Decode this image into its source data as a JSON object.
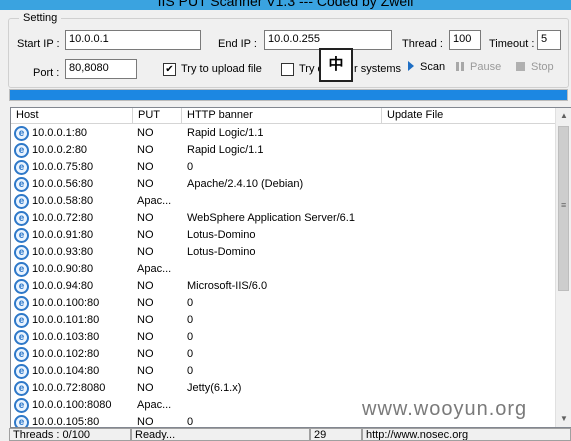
{
  "window": {
    "title": "IIS PUT Scanner V1.3 --- Coded by Zwell"
  },
  "settings": {
    "legend": "Setting",
    "start_ip_label": "Start IP :",
    "start_ip_value": "10.0.0.1",
    "end_ip_label": "End IP :",
    "end_ip_value": "10.0.0.255",
    "thread_label": "Thread :",
    "thread_value": "100",
    "timeout_label": "Timeout :",
    "timeout_value": "5",
    "port_label": "Port :",
    "port_value": "80,8080",
    "upload_label": "Try to upload file",
    "upload_checked": true,
    "other_label": "Try o",
    "other_label_tail": "r systems",
    "other_checked": false,
    "ime_glyph": "中"
  },
  "toolbar": {
    "scan_label": "Scan",
    "pause_label": "Pause",
    "stop_label": "Stop"
  },
  "progress": {
    "value": 1.0,
    "color": "#1c87e2"
  },
  "table": {
    "columns": [
      "Host",
      "PUT",
      "HTTP banner",
      "Update File"
    ],
    "rows": [
      {
        "host": "10.0.0.1:80",
        "put": "NO",
        "banner": "Rapid Logic/1.1",
        "update": ""
      },
      {
        "host": "10.0.0.2:80",
        "put": "NO",
        "banner": "Rapid Logic/1.1",
        "update": ""
      },
      {
        "host": "10.0.0.75:80",
        "put": "NO",
        "banner": "0",
        "update": ""
      },
      {
        "host": "10.0.0.56:80",
        "put": "NO",
        "banner": "Apache/2.4.10 (Debian)",
        "update": ""
      },
      {
        "host": "10.0.0.58:80",
        "put": "Apac...",
        "banner": "",
        "update": ""
      },
      {
        "host": "10.0.0.72:80",
        "put": "NO",
        "banner": "WebSphere Application Server/6.1",
        "update": ""
      },
      {
        "host": "10.0.0.91:80",
        "put": "NO",
        "banner": "Lotus-Domino",
        "update": ""
      },
      {
        "host": "10.0.0.93:80",
        "put": "NO",
        "banner": "Lotus-Domino",
        "update": ""
      },
      {
        "host": "10.0.0.90:80",
        "put": "Apac...",
        "banner": "",
        "update": ""
      },
      {
        "host": "10.0.0.94:80",
        "put": "NO",
        "banner": "Microsoft-IIS/6.0",
        "update": ""
      },
      {
        "host": "10.0.0.100:80",
        "put": "NO",
        "banner": "0",
        "update": ""
      },
      {
        "host": "10.0.0.101:80",
        "put": "NO",
        "banner": "0",
        "update": ""
      },
      {
        "host": "10.0.0.103:80",
        "put": "NO",
        "banner": "0",
        "update": ""
      },
      {
        "host": "10.0.0.102:80",
        "put": "NO",
        "banner": "0",
        "update": ""
      },
      {
        "host": "10.0.0.104:80",
        "put": "NO",
        "banner": "0",
        "update": ""
      },
      {
        "host": "10.0.0.72:8080",
        "put": "NO",
        "banner": "Jetty(6.1.x)",
        "update": ""
      },
      {
        "host": "10.0.0.100:8080",
        "put": "Apac...",
        "banner": "",
        "update": ""
      },
      {
        "host": "10.0.0.105:80",
        "put": "NO",
        "banner": "0",
        "update": ""
      }
    ],
    "host_icon": "ie-globe-icon"
  },
  "statusbar": {
    "threads": "Threads : 0/100",
    "status": "Ready...",
    "count": "29",
    "url": "http://www.nosec.org"
  },
  "watermark": "www.wooyun.org"
}
